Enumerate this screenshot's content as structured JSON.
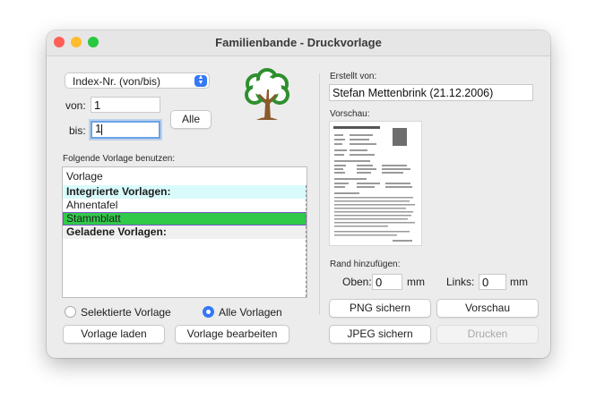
{
  "window": {
    "title": "Familienbande - Druckvorlage"
  },
  "colors": {
    "close": "#ff5f57",
    "minimize": "#febc2e",
    "zoom": "#28c840",
    "accent": "#3478f6",
    "selected_row": "#32c84a",
    "header_row": "#d9fbfb"
  },
  "index_select": {
    "value": "Index-Nr. (von/bis)"
  },
  "von": {
    "label": "von:",
    "value": "1"
  },
  "bis": {
    "label": "bis:",
    "value": "1"
  },
  "alle_button": "Alle",
  "logo": {
    "icon": "tree-icon"
  },
  "template_section": {
    "label": "Folgende Vorlage benutzen:"
  },
  "template_list": {
    "rows": [
      {
        "text": "Vorlage",
        "bold": false
      },
      {
        "text": "Integrierte Vorlagen:",
        "bold": true
      },
      {
        "text": "Ahnentafel",
        "bold": false
      },
      {
        "text": "Stammblatt",
        "bold": false
      },
      {
        "text": "Geladene Vorlagen:",
        "bold": true
      }
    ],
    "selected": "Stammblatt"
  },
  "radio": {
    "selected_label": "Selektierte Vorlage",
    "all_label": "Alle Vorlagen",
    "active": "Alle Vorlagen"
  },
  "buttons": {
    "load": "Vorlage laden",
    "edit": "Vorlage bearbeiten",
    "png": "PNG sichern",
    "preview": "Vorschau",
    "jpeg": "JPEG sichern",
    "print": "Drucken"
  },
  "created_by": {
    "label": "Erstellt von:",
    "value": "Stefan Mettenbrink (21.12.2006)"
  },
  "preview": {
    "label": "Vorschau:"
  },
  "margins": {
    "label": "Rand hinzufügen:",
    "top_label": "Oben:",
    "top_value": "0",
    "left_label": "Links:",
    "left_value": "0",
    "unit": "mm"
  }
}
